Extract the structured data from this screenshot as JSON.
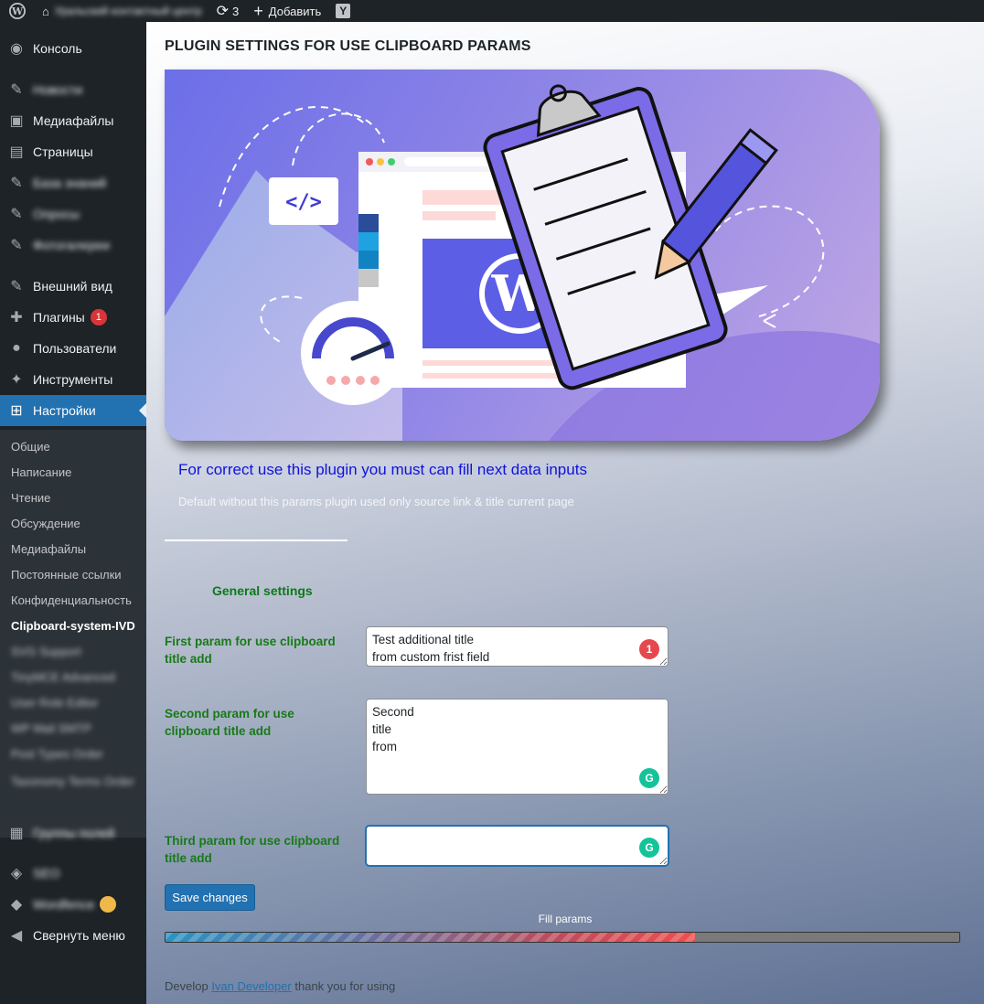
{
  "adminbar": {
    "wp_logo_icon": "wordpress-icon",
    "site_name": "Уральский контактный центр",
    "updates_count": "3",
    "add_new": "Добавить",
    "yoast_icon": "yoast-icon"
  },
  "sidebar": {
    "items": [
      {
        "icon": "dashboard-icon",
        "label": "Консоль"
      },
      {
        "icon": "pin-icon",
        "label": "Новости"
      },
      {
        "icon": "media-icon",
        "label": "Медиафайлы"
      },
      {
        "icon": "page-icon",
        "label": "Страницы"
      },
      {
        "icon": "pin-icon",
        "label": "База знаний"
      },
      {
        "icon": "pin-icon",
        "label": "Опросы"
      },
      {
        "icon": "pin-icon",
        "label": "Фотогалереи"
      },
      {
        "icon": "appearance-icon",
        "label": "Внешний вид"
      },
      {
        "icon": "plugins-icon",
        "label": "Плагины",
        "badge": "1"
      },
      {
        "icon": "users-icon",
        "label": "Пользователи"
      },
      {
        "icon": "tools-icon",
        "label": "Инструменты"
      },
      {
        "icon": "settings-icon",
        "label": "Настройки"
      },
      {
        "icon": "fields-icon",
        "label": "Группы полей"
      },
      {
        "icon": "seo-icon",
        "label": "SEO"
      },
      {
        "icon": "wordfence-icon",
        "label": "Wordfence"
      },
      {
        "icon": "collapse-icon",
        "label": "Свернуть меню"
      }
    ],
    "submenu": [
      "Общие",
      "Написание",
      "Чтение",
      "Обсуждение",
      "Медиафайлы",
      "Постоянные ссылки",
      "Конфиденциальность",
      "Clipboard-system-IVD",
      "SVG Support",
      "TinyMCE Advanced",
      "User Role Editor",
      "WP Mail SMTP",
      "Post Types Order",
      "Taxonomy Terms Order"
    ]
  },
  "page": {
    "title": "PLUGIN SETTINGS FOR USE CLIPBOARD PARAMS",
    "intro": "For correct use this plugin you must can fill next data inputs",
    "sub_intro": "Default without this params plugin used only source link & title current page",
    "section_title": "General settings",
    "fields": [
      {
        "label": "First param for use clipboard title add",
        "value": "Test additional title\nfrom custom frist field",
        "badge": "1"
      },
      {
        "label": "Second param for use clipboard title add",
        "value": "Second\ntitle\nfrom"
      },
      {
        "label": "Third param for use clipboard title add",
        "value": ""
      }
    ],
    "save_label": "Save changes",
    "fill_label": "Fill params",
    "fill_progress": 0.667,
    "footer_prefix": "Develop ",
    "footer_link": "Ivan Developer",
    "footer_suffix": " thank you for using"
  },
  "banner": {
    "code_tag": "</>"
  },
  "colors": {
    "accent": "#2271b1",
    "sidebar_bg": "#1d2327",
    "label_green": "#187a18",
    "intro_blue": "#1111dd"
  }
}
